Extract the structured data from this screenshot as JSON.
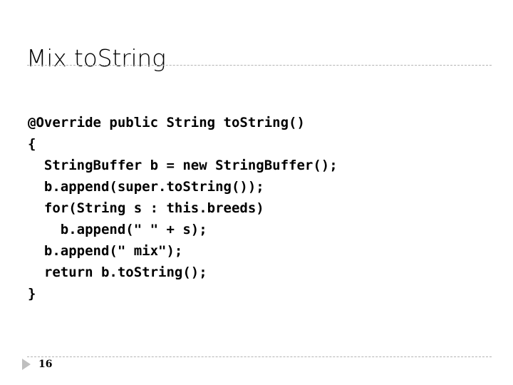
{
  "slide": {
    "title": "Mix toString",
    "page_number": "16",
    "bullet_icon": "triangle-right-icon",
    "divider_color": "#b3b3b3",
    "bullet_color": "#bfbfbf",
    "text_color": "#000000",
    "background_color": "#ffffff"
  },
  "code": {
    "language": "java",
    "lines": [
      "@Override public String toString()",
      "{",
      "  StringBuffer b = new StringBuffer();",
      "  b.append(super.toString());",
      "  for(String s : this.breeds)",
      "    b.append(\" \" + s);",
      "  b.append(\" mix\");",
      "  return b.toString();",
      "}"
    ]
  }
}
